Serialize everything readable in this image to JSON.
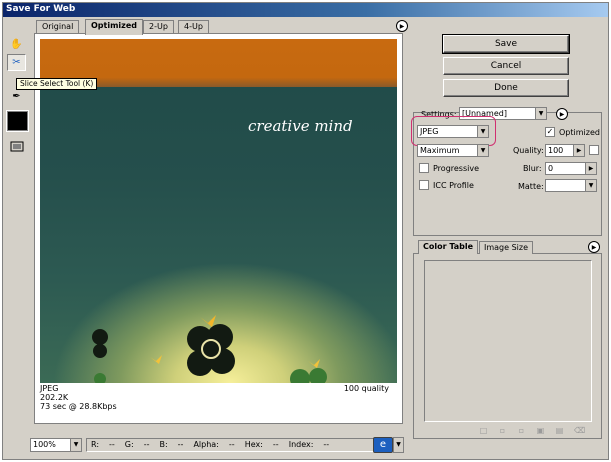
{
  "window": {
    "title": "Save For Web"
  },
  "tooltip": {
    "text": "Slice Select Tool (K)"
  },
  "tabs": [
    {
      "label": "Original"
    },
    {
      "label": "Optimized",
      "selected": true
    },
    {
      "label": "2-Up"
    },
    {
      "label": "4-Up"
    }
  ],
  "preview": {
    "image_text": "creative mind",
    "format": "JPEG",
    "size": "202.2K",
    "download_time": "73 sec @ 28.8Kbps",
    "quality_text": "100 quality"
  },
  "status": {
    "zoom": "100%",
    "readouts": [
      "R:",
      "--",
      "G:",
      "--",
      "B:",
      "--",
      "Alpha:",
      "--",
      "Hex:",
      "--",
      "Index:",
      "--"
    ]
  },
  "buttons": {
    "save": "Save",
    "cancel": "Cancel",
    "done": "Done"
  },
  "settings": {
    "label": "Settings:",
    "preset": "[Unnamed]",
    "format": "JPEG",
    "optimized_label": "Optimized",
    "optimized_checked": true,
    "compression": "Maximum",
    "quality_label": "Quality:",
    "quality": "100",
    "progressive_label": "Progressive",
    "icc_label": "ICC Profile",
    "blur_label": "Blur:",
    "blur": "0",
    "matte_label": "Matte:",
    "matte": ""
  },
  "color_panel": {
    "tabs": [
      "Color Table",
      "Image Size"
    ]
  },
  "icons": {
    "hand": "✋",
    "slice": "✂",
    "zoom": "🔍",
    "eyedropper": "✒",
    "menu": "▶",
    "arrow": "▼",
    "check": "✓",
    "browser": "e",
    "color_tools": [
      "□",
      "▫",
      "▫",
      "▣",
      "▤",
      "⌫"
    ]
  },
  "colors": {
    "accent_highlight": "#d03070",
    "sky": "#c86a10",
    "teal": "#1f4a48"
  }
}
